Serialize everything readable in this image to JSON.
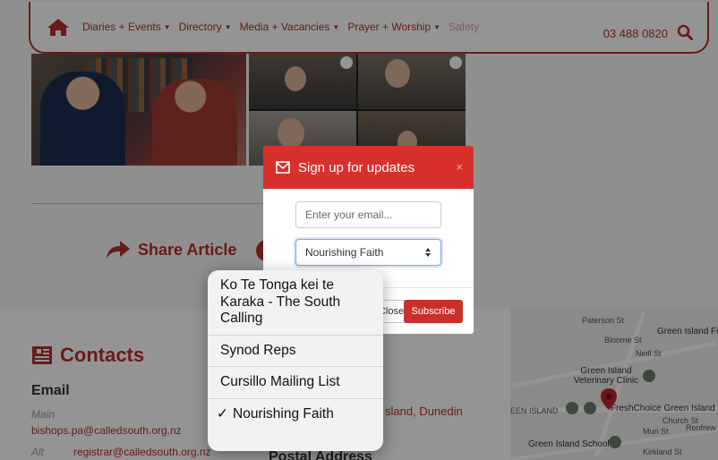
{
  "nav": {
    "items": [
      {
        "label": "Diaries + Events"
      },
      {
        "label": "Directory"
      },
      {
        "label": "Media + Vacancies"
      },
      {
        "label": "Prayer + Worship"
      },
      {
        "label": "Safety"
      }
    ],
    "phone": "03 488 0820",
    "brand_color": "#b5302c"
  },
  "article": {
    "share_label": "Share Article"
  },
  "contacts": {
    "title": "Contacts",
    "email_heading": "Email",
    "main_label": "Main",
    "main_email": "bishops.pa@calledsouth.org.nz",
    "alt_label": "Alt",
    "alt_email": "registrar@calledsouth.org.nz",
    "address_fragment": "sland, Dunedin",
    "postal_heading": "Postal Address"
  },
  "map": {
    "labels": [
      "Paterson St",
      "Bloome St",
      "Green Island Footb",
      "Neill St",
      "Green Island Veterinary Clinic",
      "FreshChoice Green Island",
      "EEN ISLAND",
      "Green Island School",
      "Muri St",
      "Renfrew St",
      "Kirkland St",
      "Church St"
    ]
  },
  "modal": {
    "title": "Sign up for updates",
    "close_symbol": "×",
    "email_placeholder": "Enter your email...",
    "selected_list": "Nourishing Faith",
    "close_label": "Close",
    "subscribe_label": "Subscribe",
    "accent": "#d8302c"
  },
  "picker": {
    "options": [
      {
        "label": "Ko Te Tonga kei te Karaka - The South Calling",
        "selected": false
      },
      {
        "label": "Synod Reps",
        "selected": false
      },
      {
        "label": "Cursillo Mailing List",
        "selected": false
      },
      {
        "label": "Nourishing Faith",
        "selected": true
      }
    ],
    "check_symbol": "✓"
  }
}
